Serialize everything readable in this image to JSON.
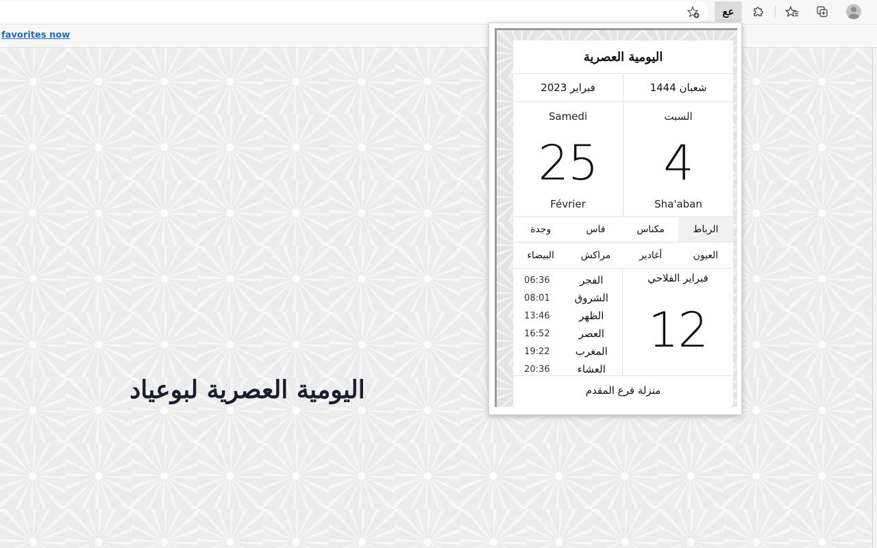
{
  "browser": {
    "favorite_star_icon": "star-add-icon",
    "extension_button_glyph": "عع",
    "extensions_icon": "puzzle-icon",
    "favorites_icon": "favorites-list-icon",
    "collections_icon": "collections-icon",
    "profile_icon": "avatar-icon",
    "favorites_bar_link": "favorites now"
  },
  "page": {
    "title": "اليومية العصرية لبوعياد"
  },
  "popup": {
    "title": "اليومية العصرية",
    "hijri_month_year": "شعبان 1444",
    "gregorian_month_year": "فبراير 2023",
    "hijri": {
      "day_name": "السبت",
      "day": "4",
      "month": "Sha'aban"
    },
    "gregorian": {
      "day_name": "Samedi",
      "day": "25",
      "month": "Février"
    },
    "cities_row1": [
      {
        "label": "الرباط",
        "selected": true
      },
      {
        "label": "مكناس",
        "selected": false
      },
      {
        "label": "فاس",
        "selected": false
      },
      {
        "label": "وجدة",
        "selected": false
      }
    ],
    "cities_row2": [
      {
        "label": "العيون",
        "selected": false
      },
      {
        "label": "أغادير",
        "selected": false
      },
      {
        "label": "مراكش",
        "selected": false
      },
      {
        "label": "البيضاء",
        "selected": false
      }
    ],
    "prayers": [
      {
        "name": "الفجر",
        "time": "06:36"
      },
      {
        "name": "الشروق",
        "time": "08:01"
      },
      {
        "name": "الظهر",
        "time": "13:46"
      },
      {
        "name": "العصر",
        "time": "16:52"
      },
      {
        "name": "المغرب",
        "time": "19:22"
      },
      {
        "name": "العشاء",
        "time": "20:36"
      }
    ],
    "fallahi": {
      "label": "فبراير الفلاحي",
      "day": "12"
    },
    "manzil": "منزلة فرع المقدم"
  }
}
